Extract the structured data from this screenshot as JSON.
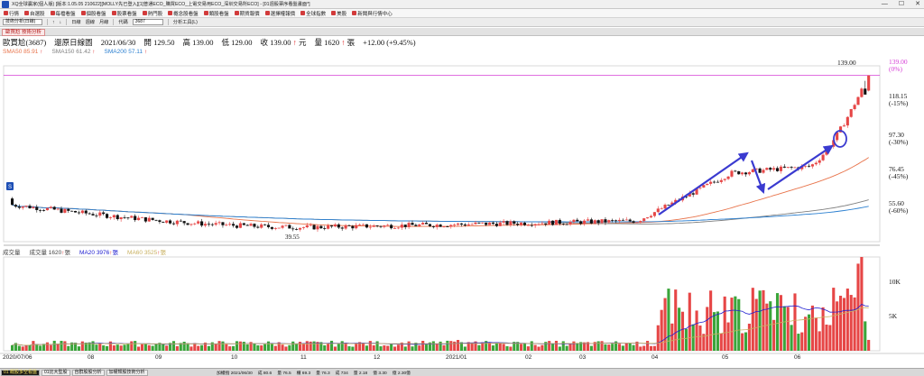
{
  "window": {
    "title": "XQ全球贏家(個人版) [版本:1.05.05 210622][MOLLY先已登入][1]普通ECO_購買ECO_上電交易用ECO_深圳交易所ECO] - [01週股票序看盤畫面*]",
    "controls": [
      "—",
      "☐",
      "✕"
    ]
  },
  "menubar": {
    "items": [
      {
        "label": "行情",
        "color": "#d23b3b"
      },
      {
        "label": "自選股",
        "color": "#d23b3b"
      },
      {
        "label": "每檔看盤",
        "color": "#d23b3b"
      },
      {
        "label": "個股看盤",
        "color": "#d23b3b"
      },
      {
        "label": "股票看盤",
        "color": "#d23b3b"
      },
      {
        "label": "熱門股",
        "color": "#d23b3b"
      },
      {
        "label": "概念股看盤",
        "color": "#d23b3b"
      },
      {
        "label": "類股看盤",
        "color": "#d23b3b"
      },
      {
        "label": "期貨報價",
        "color": "#d23b3b"
      },
      {
        "label": "選擇權報價",
        "color": "#d23b3b"
      },
      {
        "label": "全球指數",
        "color": "#d23b3b"
      },
      {
        "label": "美股",
        "color": "#d23b3b"
      },
      {
        "label": "新聞與行情中心",
        "color": "#d23b3b"
      }
    ]
  },
  "toolbar": {
    "layout_select": "技術分析(日線)",
    "symbol_label": "代碼",
    "symbol_value": "3687",
    "buttons": [
      "↑",
      "↓",
      "日線",
      "週線",
      "月線",
      "分析工具(L)"
    ]
  },
  "tab": {
    "label": "歐買尬 技術分析"
  },
  "infobar": {
    "stock": "歐買尬(3687)",
    "period": "還原日線圖",
    "date": "2021/06/30",
    "open_label": "開",
    "open": "129.50",
    "high_label": "高",
    "high": "139.00",
    "low_label": "低",
    "low": "129.00",
    "close_label": "收",
    "close": "139.00",
    "unit_label": "元",
    "volume_label": "量",
    "volume": "1620",
    "volume_unit": "張",
    "change": "+12.00 (+9.45%)"
  },
  "legend": {
    "sma50": "SMA50 85.91",
    "sma150": "SMA150 61.42",
    "sma200": "SMA200 57.11",
    "volume_title": "成交量",
    "volume_value": "成交量 1620",
    "volume_unit": "張",
    "ma20": "MA20 3976",
    "ma60": "MA60 3525"
  },
  "colors": {
    "up": "#e64646",
    "down": "#111111",
    "vol_up": "#e64646",
    "vol_down": "#3aa53a",
    "sma50": "#e8734a",
    "sma150": "#808080",
    "sma200": "#2a7fd0",
    "ma20": "#2020d0",
    "ma60": "#c8b060",
    "annotation": "#3a3ad0",
    "highlight": "#d640d6"
  },
  "price_axis": {
    "top_label": "139.00",
    "top_pct": "(0%)",
    "labels": [
      {
        "price": "118.15",
        "pct": "(-15%)"
      },
      {
        "price": "97.30",
        "pct": "(-30%)"
      },
      {
        "price": "76.45",
        "pct": "(-45%)"
      },
      {
        "price": "55.60",
        "pct": "(-60%)"
      }
    ],
    "low_marker": "39.55",
    "high_marker": "139.00"
  },
  "volume_axis": {
    "labels": [
      "10K",
      "5K"
    ]
  },
  "timeline": {
    "start": "2020/07/06",
    "months": [
      "08",
      "09",
      "10",
      "11",
      "12",
      "2021/01",
      "02",
      "03",
      "04",
      "05",
      "06"
    ]
  },
  "chart_data": {
    "type": "candlestick",
    "title": "歐買尬(3687) 還原日線圖",
    "last_close": 139.0,
    "period_low": 39.55,
    "period_high": 139.0,
    "ylim": [
      35,
      145
    ],
    "volume_ylim": [
      0,
      14000
    ]
  },
  "bottom_tabs": [
    {
      "label": "01 概股多空看盤",
      "active": true
    },
    {
      "label": "01比大型股"
    },
    {
      "label": "自群股股分析"
    },
    {
      "label": "加權類股技術分析"
    }
  ],
  "status": {
    "items": [
      "加權指 2021/06/30",
      "成 80.6",
      "量 76.5",
      "櫃 69.3",
      "量 76.3",
      "成 734",
      "量 2.18",
      "億 3.30",
      "億 2.30億"
    ],
    "clock": "上午 11:07",
    "right_items": [
      "下單區",
      "專家 功能",
      "交易 機制"
    ]
  }
}
